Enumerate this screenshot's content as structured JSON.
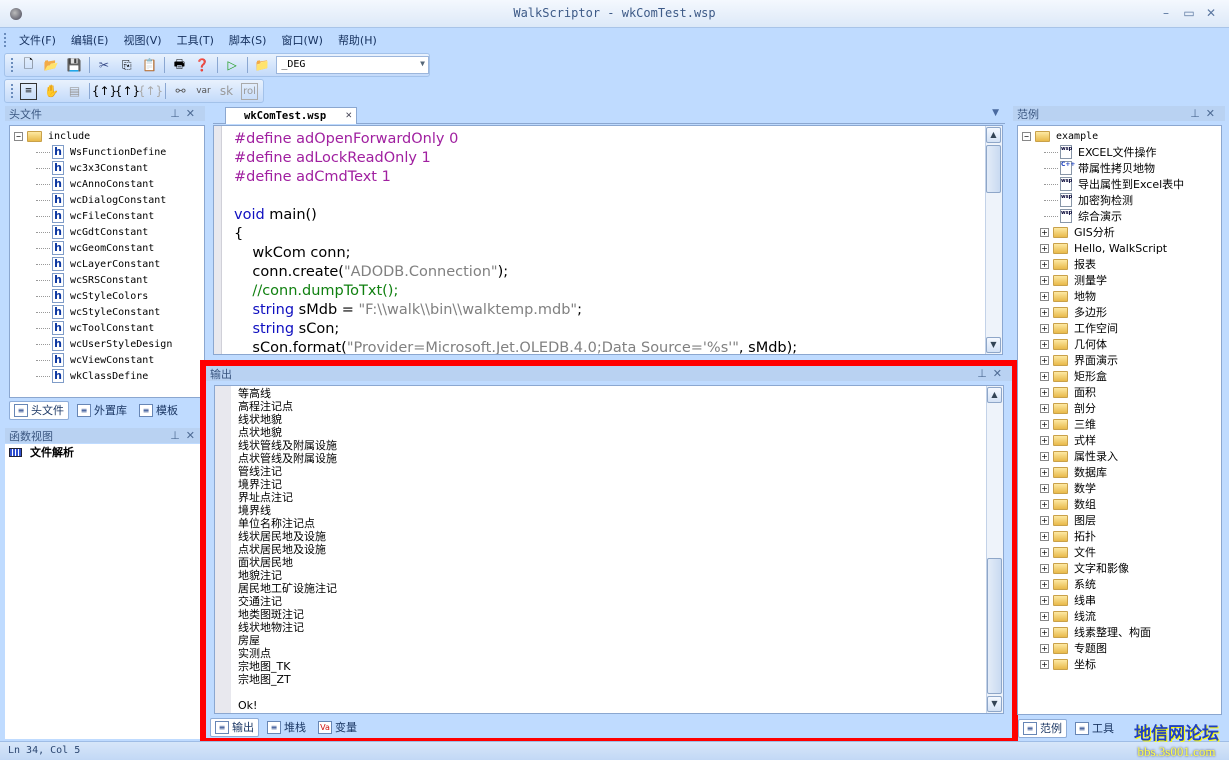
{
  "window": {
    "title": "WalkScriptor - wkComTest.wsp",
    "minimize": "–",
    "maximize": "▭",
    "close": "✕"
  },
  "menu": [
    "文件(F)",
    "编辑(E)",
    "视图(V)",
    "工具(T)",
    "脚本(S)",
    "窗口(W)",
    "帮助(H)"
  ],
  "toolbar": {
    "combo_value": "_DEG",
    "var_label": "var",
    "sk_label": "sk",
    "rol_label": "rol"
  },
  "left_panel": {
    "title": "头文件",
    "root": "include",
    "items": [
      "WsFunctionDefine",
      "wc3x3Constant",
      "wcAnnoConstant",
      "wcDialogConstant",
      "wcFileConstant",
      "wcGdtConstant",
      "wcGeomConstant",
      "wcLayerConstant",
      "wcSRSConstant",
      "wcStyleColors",
      "wcStyleConstant",
      "wcToolConstant",
      "wcUserStyleDesign",
      "wcViewConstant",
      "wkClassDefine"
    ],
    "tabs": [
      "头文件",
      "外置库",
      "模板"
    ]
  },
  "func_panel": {
    "title": "函数视图",
    "item": "文件解析"
  },
  "editor": {
    "tab": "wkComTest.wsp",
    "lines": [
      [
        {
          "t": "#define adOpenForwardOnly 0",
          "c": "#a020a0"
        }
      ],
      [
        {
          "t": "#define adLockReadOnly 1",
          "c": "#a020a0"
        }
      ],
      [
        {
          "t": "#define adCmdText 1",
          "c": "#a020a0"
        }
      ],
      [
        {
          "t": "",
          "c": "#000"
        }
      ],
      [
        {
          "t": "void",
          "c": "#1010c0"
        },
        {
          "t": " main()",
          "c": "#000"
        }
      ],
      [
        {
          "t": "{",
          "c": "#000"
        }
      ],
      [
        {
          "t": "    wkCom conn;",
          "c": "#000"
        }
      ],
      [
        {
          "t": "    conn.create(",
          "c": "#000"
        },
        {
          "t": "\"ADODB.Connection\"",
          "c": "#808080"
        },
        {
          "t": ");",
          "c": "#000"
        }
      ],
      [
        {
          "t": "    //conn.dumpToTxt();",
          "c": "#108010"
        }
      ],
      [
        {
          "t": "    ",
          "c": "#000"
        },
        {
          "t": "string",
          "c": "#1010c0"
        },
        {
          "t": " sMdb = ",
          "c": "#000"
        },
        {
          "t": "\"F:\\\\walk\\\\bin\\\\walktemp.mdb\"",
          "c": "#808080"
        },
        {
          "t": ";",
          "c": "#000"
        }
      ],
      [
        {
          "t": "    ",
          "c": "#000"
        },
        {
          "t": "string",
          "c": "#1010c0"
        },
        {
          "t": " sCon;",
          "c": "#000"
        }
      ],
      [
        {
          "t": "    sCon.format(",
          "c": "#000"
        },
        {
          "t": "\"Provider=Microsoft.Jet.OLEDB.4.0;Data Source='%s'\"",
          "c": "#808080"
        },
        {
          "t": ", sMdb);",
          "c": "#000"
        }
      ]
    ]
  },
  "output": {
    "title": "输出",
    "lines": [
      "等高线",
      "高程注记点",
      "线状地貌",
      "点状地貌",
      "线状管线及附属设施",
      "点状管线及附属设施",
      "管线注记",
      "境界注记",
      "界址点注记",
      "境界线",
      "单位名称注记点",
      "线状居民地及设施",
      "点状居民地及设施",
      "面状居民地",
      "地貌注记",
      "居民地工矿设施注记",
      "交通注记",
      "地类图斑注记",
      "线状地物注记",
      "房屋",
      "实测点",
      "宗地图_TK",
      "宗地图_ZT",
      "",
      "Ok!"
    ],
    "tabs": [
      "输出",
      "堆栈",
      "变量"
    ]
  },
  "right_panel": {
    "title": "范例",
    "root": "example",
    "files": [
      {
        "name": "EXCEL文件操作",
        "icon": "wsp"
      },
      {
        "name": "带属性拷贝地物",
        "icon": "cpp"
      },
      {
        "name": "导出属性到Excel表中",
        "icon": "wsp"
      },
      {
        "name": "加密狗检测",
        "icon": "wsp"
      },
      {
        "name": "综合演示",
        "icon": "wsp"
      }
    ],
    "folders": [
      "GIS分析",
      "Hello, WalkScript",
      "报表",
      "测量学",
      "地物",
      "多边形",
      "工作空间",
      "几何体",
      "界面演示",
      "矩形盒",
      "面积",
      "剖分",
      "三维",
      "式样",
      "属性录入",
      "数据库",
      "数学",
      "数组",
      "图层",
      "拓扑",
      "文件",
      "文字和影像",
      "系统",
      "线串",
      "线流",
      "线素整理、构面",
      "专题图",
      "坐标"
    ],
    "tabs": [
      "范例",
      "工具"
    ]
  },
  "status": {
    "position": "Ln 34, Col 5"
  },
  "watermark": {
    "line1": "地信网论坛",
    "line2": "bbs.3s001.com"
  },
  "colors": {
    "highlight_border": "#ff0000",
    "panel_bg": "#bfdbff"
  }
}
